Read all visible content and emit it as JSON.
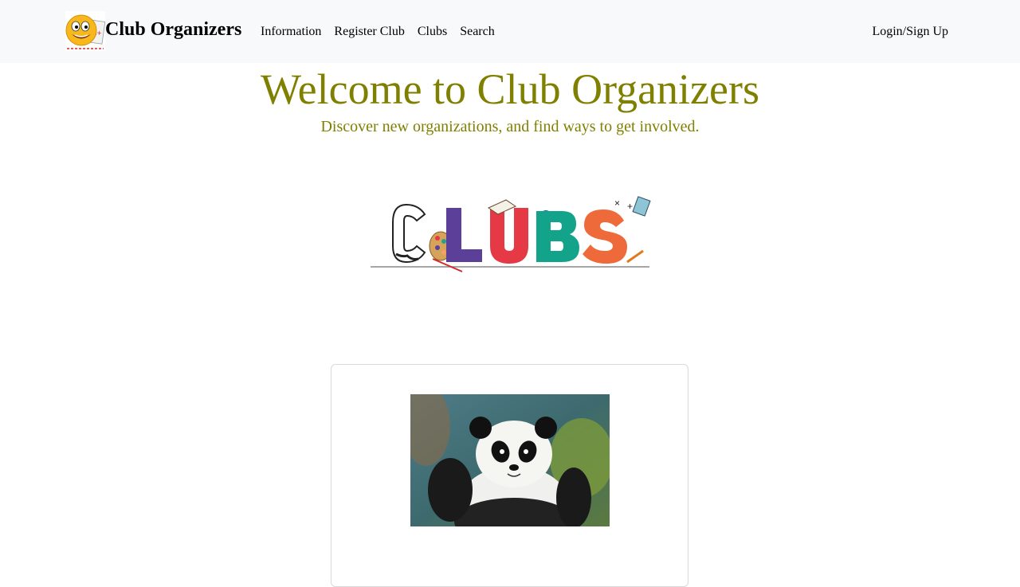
{
  "navbar": {
    "brand_name": "Club Organizers",
    "logo_icon": "smiley-grade-report-icon",
    "links": [
      {
        "label": "Information"
      },
      {
        "label": "Register Club"
      },
      {
        "label": "Clubs"
      },
      {
        "label": "Search"
      }
    ],
    "login_label": "Login/Sign Up"
  },
  "hero": {
    "title": "Welcome to Club Organizers",
    "subtitle": "Discover new organizations, and find ways to get involved."
  },
  "banner": {
    "text": "CLUBS",
    "letter_colors": [
      "#ffffff",
      "#5b3f98",
      "#e63946",
      "#12a38a",
      "#ef6a3a"
    ]
  },
  "card": {
    "image_icon": "panda-photo"
  },
  "colors": {
    "accent_text": "#808000",
    "navbar_bg": "#f8f9fa"
  }
}
